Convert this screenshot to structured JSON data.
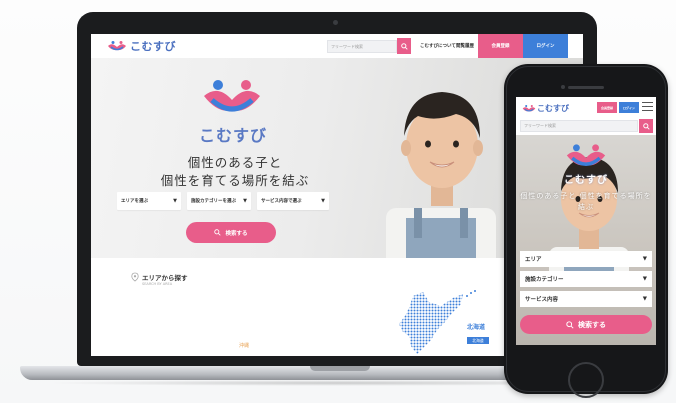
{
  "brand": {
    "name": "こむすび",
    "colors": {
      "pink": "#e85d8a",
      "blue": "#3d7fd9",
      "logo_blue": "#4a6fbf"
    }
  },
  "desktop": {
    "header": {
      "search_placeholder": "フリーワード検索",
      "nav_about": "こむすびについて",
      "nav_history": "閲覧履歴",
      "register_label": "会員登録",
      "login_label": "ログイン"
    },
    "hero": {
      "catch_line1": "個性のある子と",
      "catch_line2": "個性を育てる場所を結ぶ",
      "select_area": "エリアを選ぶ",
      "select_facility": "施設カテゴリーを選ぶ",
      "select_service": "サービス内容で選ぶ",
      "search_button": "検索する"
    },
    "area_section": {
      "title": "エリアから探す",
      "subtitle": "SEARCH BY AREA",
      "okinawa": "沖縄",
      "hokkaido": "北海道",
      "hokkaido_tag": "北海道"
    }
  },
  "mobile": {
    "header": {
      "register_label": "会員登録",
      "login_label": "ログイン",
      "search_placeholder": "フリーワード検索"
    },
    "hero": {
      "catch": "個性のある子と 個性を育てる場所を結ぶ",
      "select_area": "エリア",
      "select_facility": "施設カテゴリー",
      "select_service": "サービス内容",
      "search_button": "検索する"
    }
  },
  "icons": [
    "search-icon",
    "map-pin-icon",
    "menu-icon",
    "dropdown-arrow-icon",
    "logo-icon"
  ]
}
